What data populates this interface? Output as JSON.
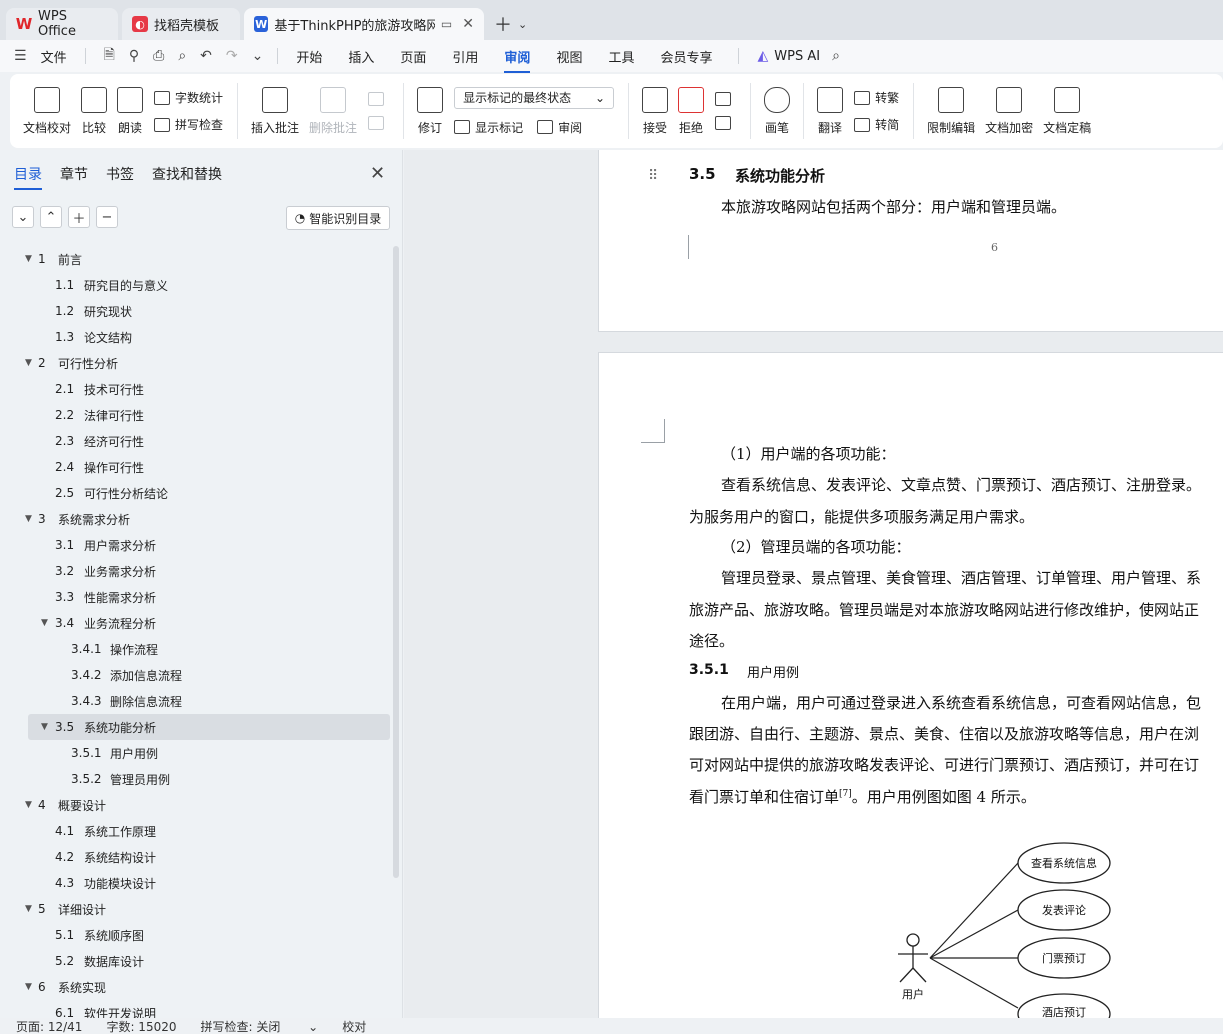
{
  "tabs": [
    {
      "label": "WPS Office"
    },
    {
      "label": "找稻壳模板"
    },
    {
      "label": "基于ThinkPHP的旅游攻略网站"
    }
  ],
  "menu": {
    "file": "文件",
    "items": [
      "开始",
      "插入",
      "页面",
      "引用",
      "审阅",
      "视图",
      "工具",
      "会员专享"
    ],
    "ai": "WPS AI"
  },
  "ribbon": {
    "doc_check": "文档校对",
    "compare": "比较",
    "read_aloud": "朗读",
    "word_count": "字数统计",
    "spell_check": "拼写检查",
    "insert_comment": "插入批注",
    "delete_comment": "删除批注",
    "revise": "修订",
    "markup_select": "显示标记的最终状态",
    "show_markup": "显示标记",
    "review": "审阅",
    "accept": "接受",
    "reject": "拒绝",
    "pen": "画笔",
    "translate": "翻译",
    "to_trad": "转繁",
    "to_simp": "转简",
    "restrict_edit": "限制编辑",
    "encrypt": "文档加密",
    "finalize": "文档定稿"
  },
  "sidebar": {
    "tabs": [
      "目录",
      "章节",
      "书签",
      "查找和替换"
    ],
    "smart_btn": "智能识别目录",
    "toc": [
      {
        "num": "1",
        "title": "前言",
        "level": 1,
        "tri": true
      },
      {
        "num": "1.1",
        "title": "研究目的与意义",
        "level": 2
      },
      {
        "num": "1.2",
        "title": "研究现状",
        "level": 2
      },
      {
        "num": "1.3",
        "title": "论文结构",
        "level": 2
      },
      {
        "num": "2",
        "title": "可行性分析",
        "level": 1,
        "tri": true
      },
      {
        "num": "2.1",
        "title": "技术可行性",
        "level": 2
      },
      {
        "num": "2.2",
        "title": "法律可行性",
        "level": 2
      },
      {
        "num": "2.3",
        "title": "经济可行性",
        "level": 2
      },
      {
        "num": "2.4",
        "title": "操作可行性",
        "level": 2
      },
      {
        "num": "2.5",
        "title": "可行性分析结论",
        "level": 2
      },
      {
        "num": "3",
        "title": "系统需求分析",
        "level": 1,
        "tri": true
      },
      {
        "num": "3.1",
        "title": "用户需求分析",
        "level": 2
      },
      {
        "num": "3.2",
        "title": "业务需求分析",
        "level": 2
      },
      {
        "num": "3.3",
        "title": "性能需求分析",
        "level": 2
      },
      {
        "num": "3.4",
        "title": "业务流程分析",
        "level": 2,
        "tri": true
      },
      {
        "num": "3.4.1",
        "title": "操作流程",
        "level": 3
      },
      {
        "num": "3.4.2",
        "title": "添加信息流程",
        "level": 3
      },
      {
        "num": "3.4.3",
        "title": "删除信息流程",
        "level": 3
      },
      {
        "num": "3.5",
        "title": "系统功能分析",
        "level": 2,
        "tri": true,
        "selected": true
      },
      {
        "num": "3.5.1",
        "title": "用户用例",
        "level": 3
      },
      {
        "num": "3.5.2",
        "title": "管理员用例",
        "level": 3
      },
      {
        "num": "4",
        "title": "概要设计",
        "level": 1,
        "tri": true
      },
      {
        "num": "4.1",
        "title": "系统工作原理",
        "level": 2
      },
      {
        "num": "4.2",
        "title": "系统结构设计",
        "level": 2
      },
      {
        "num": "4.3",
        "title": "功能模块设计",
        "level": 2
      },
      {
        "num": "5",
        "title": "详细设计",
        "level": 1,
        "tri": true
      },
      {
        "num": "5.1",
        "title": "系统顺序图",
        "level": 2
      },
      {
        "num": "5.2",
        "title": "数据库设计",
        "level": 2
      },
      {
        "num": "6",
        "title": "系统实现",
        "level": 1,
        "tri": true
      },
      {
        "num": "6.1",
        "title": "软件开发说明",
        "level": 2
      }
    ]
  },
  "doc": {
    "h35_num": "3.5",
    "h35_title": "系统功能分析",
    "p_intro": "本旅游攻略网站包括两个部分：用户端和管理员端。",
    "page_num": "6",
    "user_title": "（1）用户端的各项功能：",
    "user_l1": "查看系统信息、发表评论、文章点赞、门票预订、酒店预订、注册登录。",
    "user_l2": "为服务用户的窗口，能提供多项服务满足用户需求。",
    "admin_title": "（2）管理员端的各项功能：",
    "admin_l1": "管理员登录、景点管理、美食管理、酒店管理、订单管理、用户管理、系",
    "admin_l2": "旅游产品、旅游攻略。管理员端是对本旅游攻略网站进行修改维护，使网站正",
    "admin_l3": "途径。",
    "h351_num": "3.5.1",
    "h351_title": "用户用例",
    "uc_l1": "在用户端，用户可通过登录进入系统查看系统信息，可查看网站信息，包",
    "uc_l2": "跟团游、自由行、主题游、景点、美食、住宿以及旅游攻略等信息，用户在浏",
    "uc_l3": "可对网站中提供的旅游攻略发表评论、可进行门票预订、酒店预订，并可在订",
    "uc_l4": "看门票订单和住宿订单",
    "uc_ref": "[7]",
    "uc_l4b": "。用户用例图如图 4 所示。",
    "diagram": {
      "actor": "用户",
      "cases": [
        "查看系统信息",
        "发表评论",
        "门票预订",
        "酒店预订"
      ]
    }
  },
  "status": {
    "page": "页面: 12/41",
    "words": "字数: 15020",
    "spell": "拼写检查: 关闭",
    "proof": "校对"
  }
}
